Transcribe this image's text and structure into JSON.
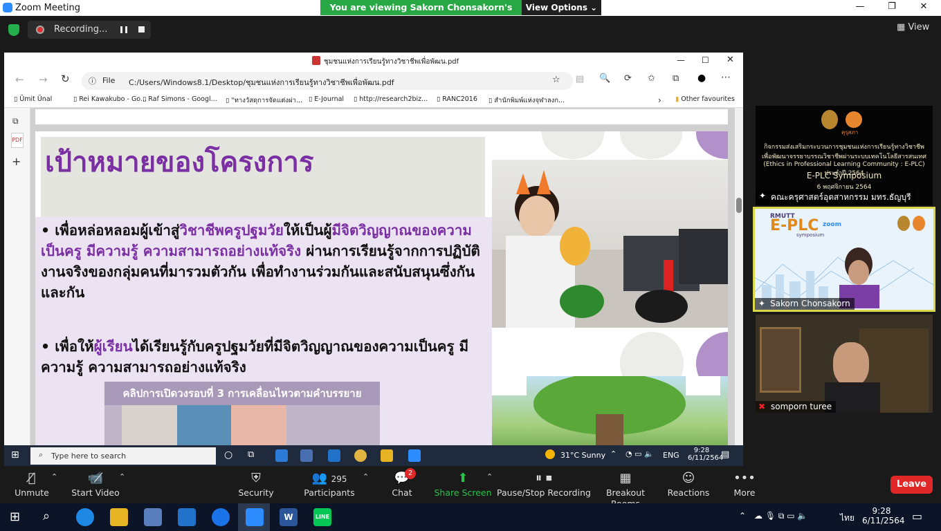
{
  "app": {
    "title": "Zoom Meeting"
  },
  "banner": {
    "viewing": "You are viewing Sakorn  Chonsakorn's screen",
    "view_options": "View Options ⌄"
  },
  "recording": {
    "label": "Recording..."
  },
  "view": {
    "label": "View"
  },
  "browser": {
    "tab_title": "ชุมชนแห่งการเรียนรู้ทางวิชาชีพเพื่อพัฒน.pdf",
    "file_label": "File",
    "url": "C:/Users/Windows8.1/Desktop/ชุมชนแห่งการเรียนรู้ทางวิชาชีพเพื่อพัฒน.pdf",
    "favorites": [
      "Ümit Ünal",
      "Rei Kawakubo - Go...",
      "Raf Simons - Googl...",
      "\"ทางวัสดุการจัดแต่งผ่า...",
      "E-Journal",
      "http://research2biz...",
      "RANC2016",
      "สำนักพิมพ์แห่งจุฬาลงก..."
    ],
    "other_fav": "Other favourites"
  },
  "slide": {
    "title": "เป้าหมายของโครงการ",
    "b1_a": "เพื่อหล่อหลอมผู้เข้าสู่",
    "b1_b": "วิชาชีพครูปฐมวัย",
    "b1_c": "ให้เป็นผู้",
    "b1_d": "มีจิตวิญญาณของความเป็นครู มีความรู้ ความสามารถอย่างแท้จริง",
    "b1_e": " ผ่านการเรียนรู้จากการปฏิบัติงานจริงของกลุ่มคนที่มารวมตัวกัน เพื่อทำงานร่วมกันและสนับสนุนซึ่งกันและกัน",
    "b2_a": "เพื่อให้",
    "b2_b": "ผู้เรียน",
    "b2_c": "ได้เรียนรู้กับครูปฐมวัยที่มีจิตวิญญาณของความเป็นครู มีความรู้ ความสามารถอย่างแท้จริง",
    "clip_caption": "คลิปการเปิดวงรอบที่ 3 การเคลื่อนไหวตามคำบรรยาย"
  },
  "inner_taskbar": {
    "search": "Type here to search",
    "weather": "31°C  Sunny",
    "lang": "ENG",
    "time": "9:28",
    "date": "6/11/2564"
  },
  "participants": {
    "tile1_lines": [
      "กิจกรรมส่งเสริมกระบวนการชุมชนแห่งการเรียนรู้ทางวิชาชีพ",
      "เพื่อพัฒนาจรรยาบรรณวิชาชีพผ่านระบบเทคโนโลยีสารสนเทศ",
      "(Ethics in Professional Learning Community : E-PLC) ประจำปี 2564",
      "E-PLC Symposium",
      "6 พฤศจิกายน 2564"
    ],
    "tile1_name": "คณะครุศาสตร์อุตสาหกรรม มทร.ธัญบุรี",
    "tile1_logo_text": "คุรุสภา",
    "tile2_brand": "RMUTT",
    "tile2_title": "E-PLC",
    "tile2_zoom": "zoom",
    "tile2_sub": "symposium",
    "tile2_name": "Sakorn  Chonsakorn",
    "tile3_name": "somporn turee"
  },
  "toolbar": {
    "unmute": "Unmute",
    "start_video": "Start Video",
    "security": "Security",
    "participants": "Participants",
    "participants_count": "295",
    "chat": "Chat",
    "chat_badge": "2",
    "share": "Share Screen",
    "pause_rec": "Pause/Stop Recording",
    "breakout": "Breakout Rooms",
    "reactions": "Reactions",
    "more": "More",
    "leave": "Leave"
  },
  "taskbar": {
    "time": "9:28",
    "date": "6/11/2564",
    "lang": "ไทย",
    "word": "W",
    "line": "LINE"
  },
  "colors": {
    "accent_purple": "#7a2fa2",
    "zoom_blue": "#2d8cff",
    "share_green": "#27a844",
    "leave_red": "#e02828"
  }
}
